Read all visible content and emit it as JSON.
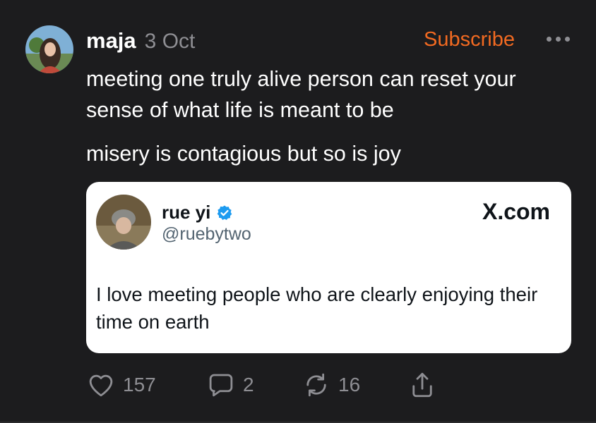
{
  "post": {
    "author": "maja",
    "date": "3 Oct",
    "subscribe_label": "Subscribe",
    "more_icon": "ellipsis-icon",
    "paragraphs": [
      "meeting one truly alive person can reset your sense of what life is meant to be",
      "misery is contagious but so is joy"
    ]
  },
  "quote": {
    "name": "rue yi",
    "handle": "@ruebytwo",
    "source": "X.com",
    "text": "I love meeting people who are clearly enjoying their time on earth",
    "verified_icon": "verified-badge-icon"
  },
  "actions": {
    "like_count": "157",
    "reply_count": "2",
    "repost_count": "16",
    "icons": [
      "heart-icon",
      "comment-icon",
      "repost-icon",
      "share-icon"
    ]
  },
  "colors": {
    "background": "#1c1c1e",
    "accent": "#f26a21",
    "muted": "#8e8e93",
    "card": "#ffffff",
    "verified": "#1d9bf0"
  }
}
